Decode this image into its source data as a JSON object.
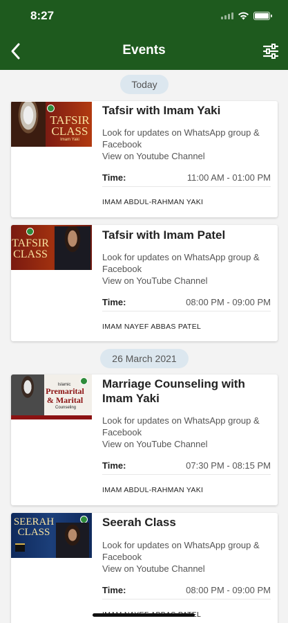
{
  "status_bar": {
    "time": "8:27"
  },
  "header": {
    "title": "Events"
  },
  "sections": [
    {
      "date": "Today"
    },
    {
      "date": "26 March 2021"
    }
  ],
  "events": [
    {
      "title": "Tafsir with Imam Yaki",
      "desc1": "Look for updates on WhatsApp group & Facebook",
      "desc2": "View on Youtube Channel",
      "time_label": "Time:",
      "time": "11:00 AM - 01:00 PM",
      "imam": "IMAM ABDUL-RAHMAN YAKI",
      "thumb_line1": "TAFSIR",
      "thumb_line2": "CLASS",
      "thumb_caption": "Imam Yaki"
    },
    {
      "title": "Tafsir with Imam Patel",
      "desc1": "Look for updates on WhatsApp group & Facebook",
      "desc2": "View on YouTube Channel",
      "time_label": "Time:",
      "time": "08:00 PM - 09:00 PM",
      "imam": "IMAM NAYEF ABBAS PATEL",
      "thumb_line1": "TAFSIR",
      "thumb_line2": "CLASS"
    },
    {
      "title": "Marriage Counseling with Imam Yaki",
      "desc1": "Look for updates on WhatsApp group & Facebook",
      "desc2": "View on YouTube Channel",
      "time_label": "Time:",
      "time": "07:30 PM - 08:15 PM",
      "imam": "IMAM ABDUL-RAHMAN YAKI",
      "thumb_line0": "Islamic",
      "thumb_line1": "Premarital",
      "thumb_line2": "& Marital",
      "thumb_caption": "Counseling"
    },
    {
      "title": "Seerah Class",
      "desc1": "Look for updates on WhatsApp group & Facebook",
      "desc2": "View on Youtube Channel",
      "time_label": "Time:",
      "time": "08:00 PM - 09:00 PM",
      "imam": "IMAM NAYEF ABBAS PATEL",
      "thumb_line1": "SEERAH",
      "thumb_line2": "CLASS"
    }
  ],
  "colors": {
    "header": "#1e5a1e",
    "pill": "#dce7ef",
    "background": "#f3f3f3"
  }
}
